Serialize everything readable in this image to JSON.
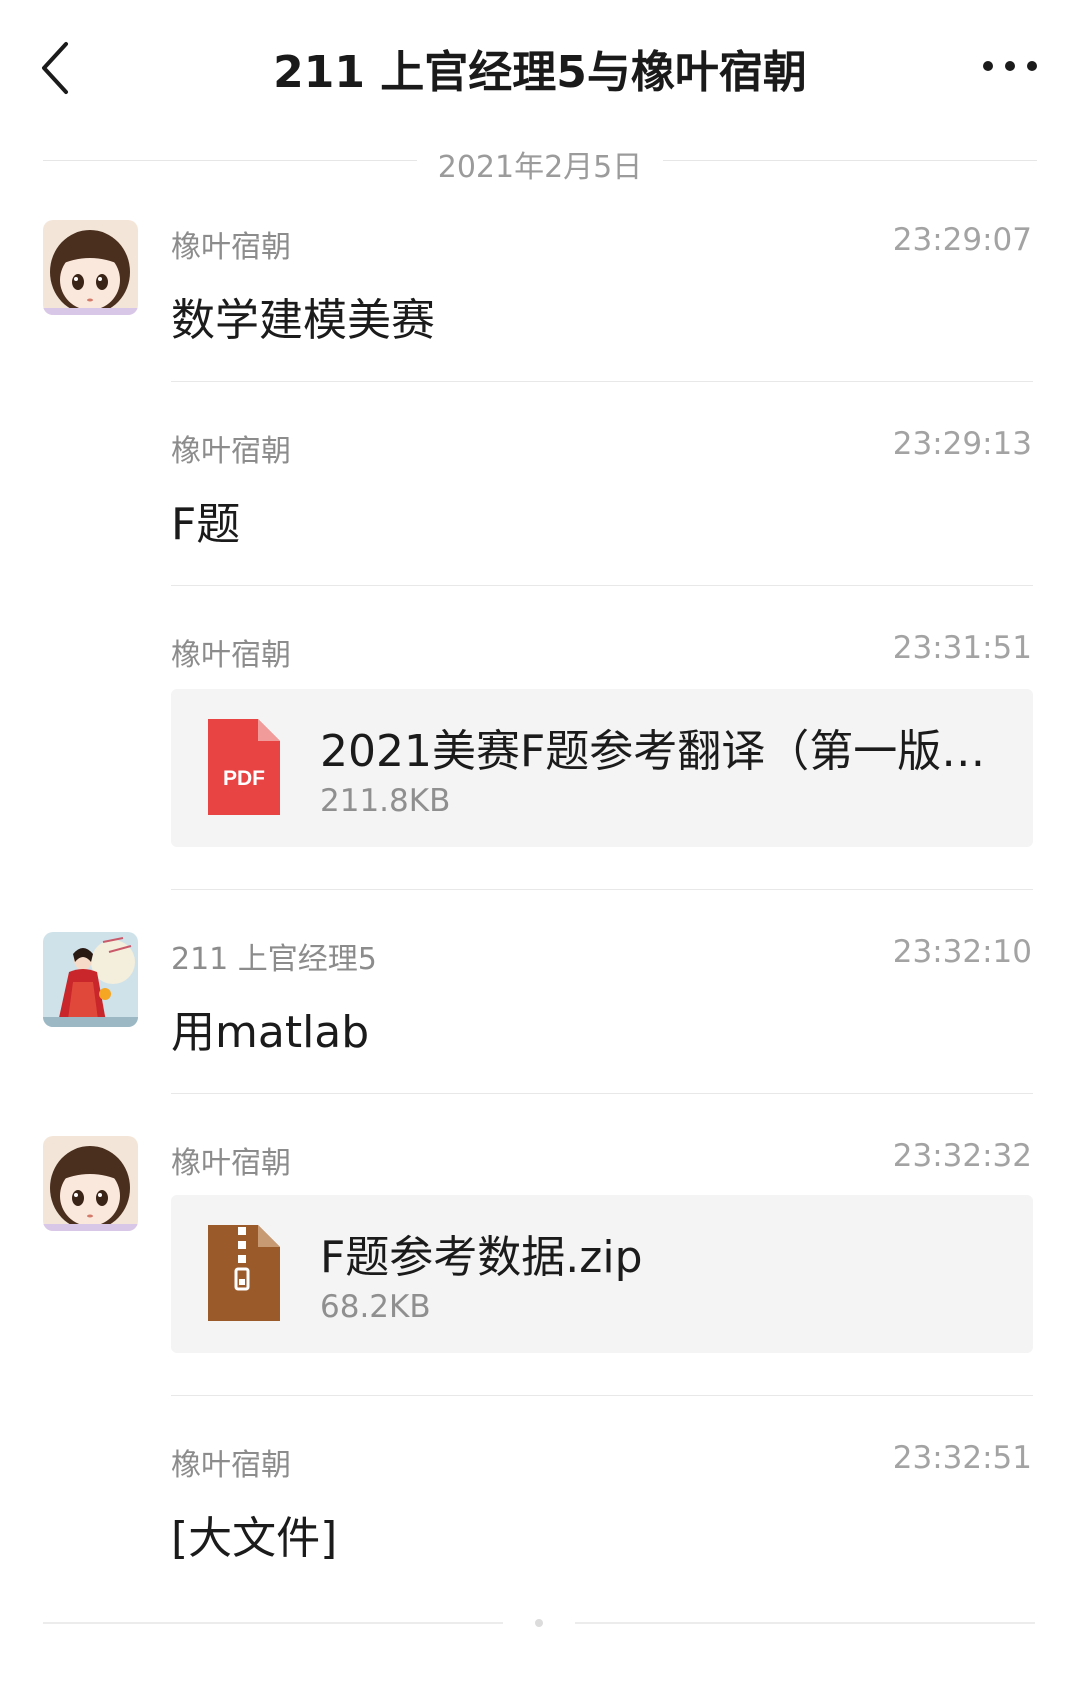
{
  "header": {
    "title": "211 上官经理5与橡叶宿朝",
    "back_icon": "chevron-left-icon",
    "more_icon": "more-dots-icon"
  },
  "date_divider": "2021年2月5日",
  "messages": [
    {
      "sender": "橡叶宿朝",
      "time": "23:29:07",
      "text": "数学建模美赛"
    },
    {
      "sender": "橡叶宿朝",
      "time": "23:29:13",
      "text": "F题"
    },
    {
      "sender": "橡叶宿朝",
      "time": "23:31:51",
      "file": {
        "name": "2021美赛F题参考翻译（第一版…",
        "size": "211.8KB",
        "icon": "pdf-file-icon",
        "icon_label": "PDF",
        "color": "#e84444"
      }
    },
    {
      "sender": "211 上官经理5",
      "time": "23:32:10",
      "text": "用matlab"
    },
    {
      "sender": "橡叶宿朝",
      "time": "23:32:32",
      "file": {
        "name": "F题参考数据.zip",
        "size": "68.2KB",
        "icon": "zip-file-icon",
        "color": "#9a5a2a"
      }
    },
    {
      "sender": "橡叶宿朝",
      "time": "23:32:51",
      "text": "[大文件]"
    }
  ]
}
